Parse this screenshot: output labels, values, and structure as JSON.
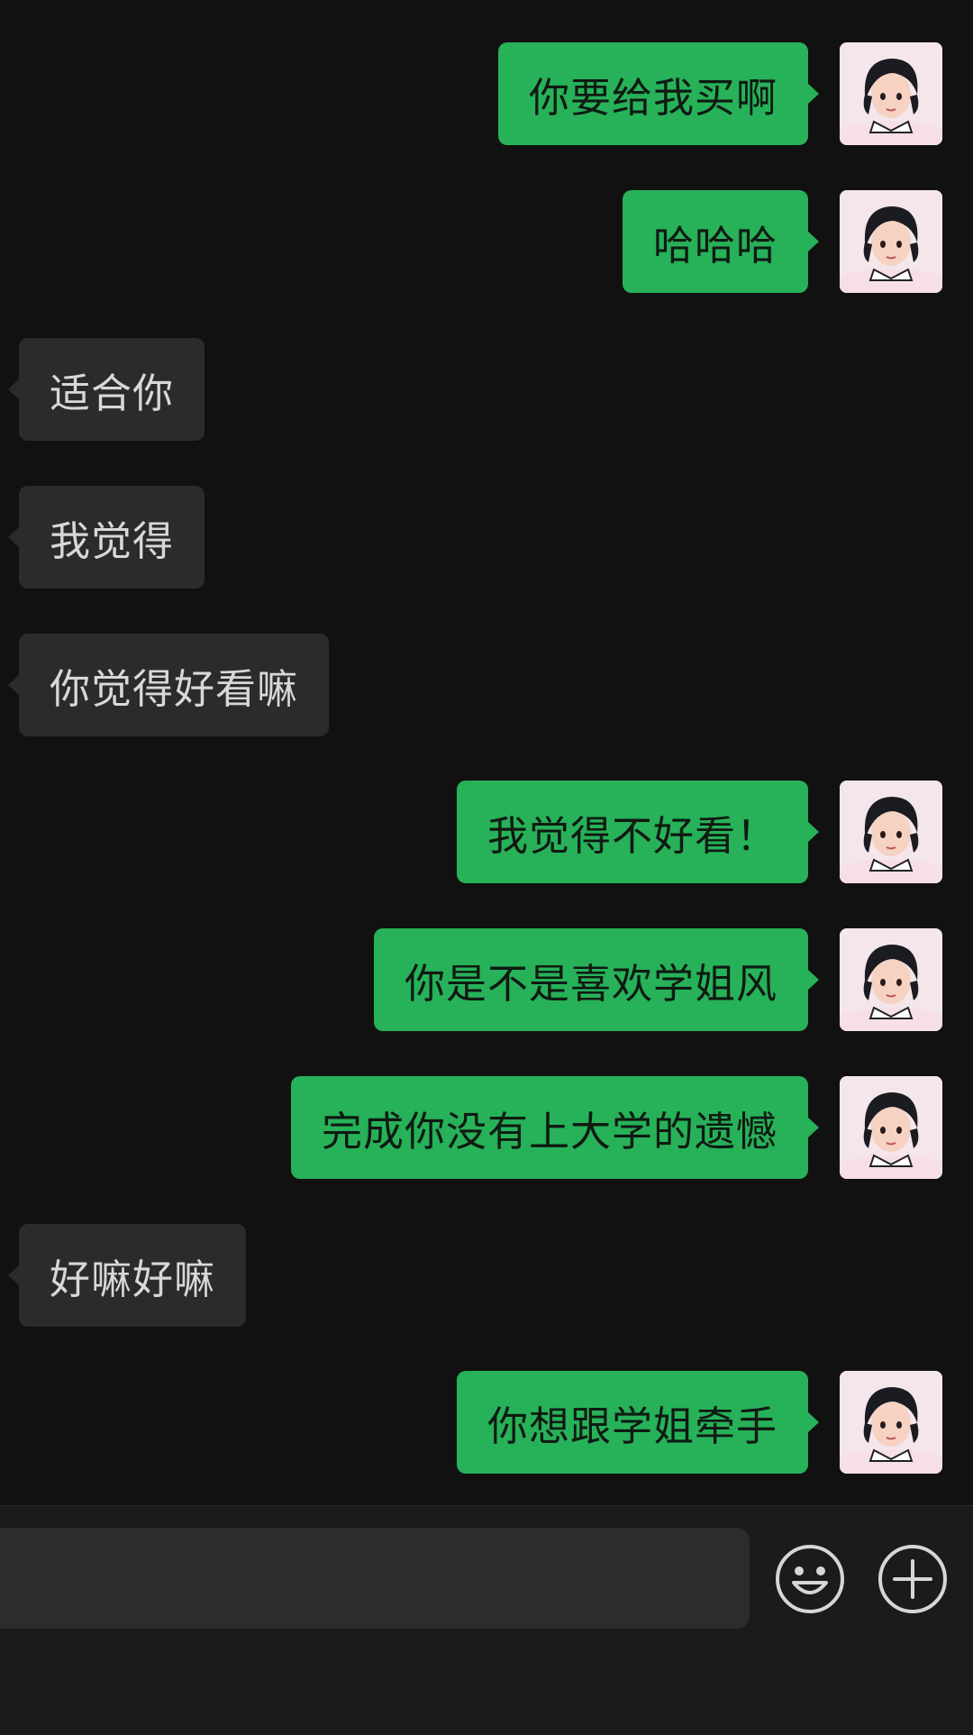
{
  "chat": {
    "messages": [
      {
        "side": "out",
        "text": "你要给我买啊"
      },
      {
        "side": "out",
        "text": "哈哈哈"
      },
      {
        "side": "in",
        "text": "适合你"
      },
      {
        "side": "in",
        "text": "我觉得"
      },
      {
        "side": "in",
        "text": "你觉得好看嘛"
      },
      {
        "side": "out",
        "text": "我觉得不好看！"
      },
      {
        "side": "out",
        "text": "你是不是喜欢学姐风"
      },
      {
        "side": "out",
        "text": "完成你没有上大学的遗憾"
      },
      {
        "side": "in",
        "text": "好嘛好嘛"
      },
      {
        "side": "out",
        "text": "你想跟学姐牵手"
      }
    ]
  },
  "input_bar": {
    "message_input": {
      "value": "",
      "placeholder": ""
    },
    "emoji_icon": "smiley-face-icon",
    "plus_icon": "plus-circle-icon"
  },
  "colors": {
    "background": "#111111",
    "outgoing_bubble": "#27b159",
    "incoming_bubble": "#2b2b2b",
    "input_bar": "#1b1b1b"
  }
}
